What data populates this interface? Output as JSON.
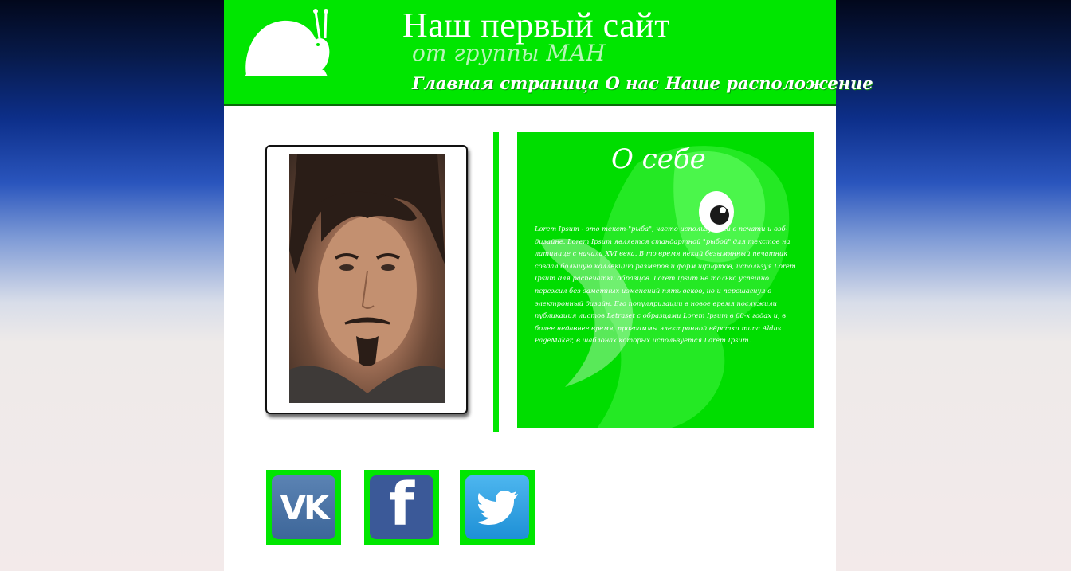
{
  "header": {
    "title": "Наш первый сайт",
    "subtitle": "от группы МАН",
    "logo_icon": "snail-icon",
    "nav": [
      {
        "label": "Главная страница"
      },
      {
        "label": "О нас"
      },
      {
        "label": "Наше расположение"
      }
    ]
  },
  "profile": {
    "photo_icon": "portrait-photo"
  },
  "about": {
    "title": "О себе",
    "text": "Lorem Ipsum - это текст-\"рыба\", часто используемый в печати и вэб-дизайне. Lorem Ipsum является стандартной \"рыбой\" для текстов на латинице с начала XVI века. В то время некий безымянный печатник создал большую коллекцию размеров и форм шрифтов, используя Lorem Ipsum для распечатки образцов. Lorem Ipsum не только успешно пережил без заметных изменений пять веков, но и перешагнул в электронный дизайн. Его популяризации в новое время послужили публикация листов Letraset с образцами Lorem Ipsum в 60-х годах и, в более недавнее время, программы электронной вёрстки типа Aldus PageMaker, в шаблонах которых используется Lorem Ipsum.",
    "background_icon": "pony-illustration"
  },
  "social": [
    {
      "name": "vk",
      "icon": "vk-icon",
      "glyph": "VK"
    },
    {
      "name": "facebook",
      "icon": "facebook-icon",
      "glyph": "f"
    },
    {
      "name": "twitter",
      "icon": "twitter-bird-icon"
    }
  ],
  "colors": {
    "accent": "#00e600",
    "header_border": "#0a6a0a",
    "vk": "#4a76a8",
    "facebook": "#3b5998",
    "twitter": "#1da1f2"
  }
}
